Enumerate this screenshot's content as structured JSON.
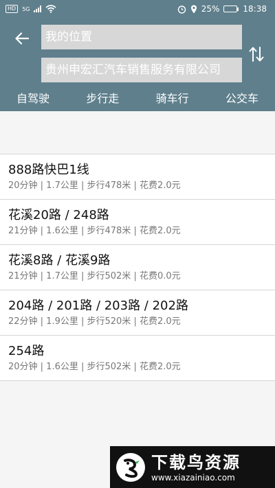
{
  "status_bar": {
    "hd_badge": "HD",
    "network": "5G",
    "battery_level": "25%",
    "battery_fraction": 0.25,
    "time": "18:38",
    "icons": [
      "hd-icon",
      "signal-icon",
      "wifi-icon",
      "alarm-icon",
      "location-icon",
      "battery-icon"
    ]
  },
  "header": {
    "from_value": "我的位置",
    "to_value": "贵州申宏汇汽车销售服务有限公司",
    "modes": [
      {
        "label": "自驾驶"
      },
      {
        "label": "步行走"
      },
      {
        "label": "骑车行"
      },
      {
        "label": "公交车"
      }
    ]
  },
  "routes": [
    {
      "name": "888路快巴1线",
      "meta": "20分钟 | 1.7公里 | 步行478米 | 花费2.0元"
    },
    {
      "name": "花溪20路 / 248路",
      "meta": "21分钟 | 1.6公里 | 步行478米 | 花费2.0元"
    },
    {
      "name": "花溪8路 / 花溪9路",
      "meta": "21分钟 | 1.7公里 | 步行502米 | 花费0.0元"
    },
    {
      "name": "204路 / 201路 / 203路 / 202路",
      "meta": "22分钟 | 1.9公里 | 步行520米 | 花费2.0元"
    },
    {
      "name": "254路",
      "meta": "20分钟 | 1.6公里 | 步行502米 | 花费2.0元"
    }
  ],
  "watermark": {
    "title": "下载鸟资源",
    "url": "www.xiazainiao.com"
  },
  "colors": {
    "header_bg": "#5f7f8c",
    "field_bg": "#d7d7d7",
    "list_bg": "#ffffff",
    "divider": "#d5d5d5"
  }
}
